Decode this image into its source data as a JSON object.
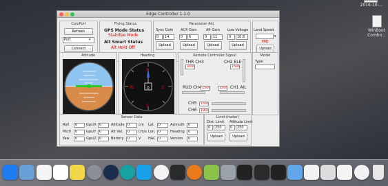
{
  "desktop": {
    "file_label": "2016-10-...",
    "winboot_label_1": "WinBoot",
    "winboot_label_2": "Combo..."
  },
  "window": {
    "title": "Edge Controller 1.1.0"
  },
  "com_port": {
    "header": "ComPort",
    "refresh_label": "Refresh",
    "port_value": "Port",
    "connect_label": "Connect"
  },
  "flying_status": {
    "header": "Flying Status",
    "gps_mode_label": "GPS Mode Status",
    "gps_mode_value": "Stabilize Mode",
    "alt_smart_label": "Alt Smart Status",
    "alt_smart_value": "Alt Hold Off"
  },
  "param_adj": {
    "header": "Parameter Adj.",
    "columns": [
      {
        "label": "Sync Gain",
        "value": "14",
        "upload": "Upload"
      },
      {
        "label": "AUX Gain",
        "value": "6",
        "upload": "Upload"
      },
      {
        "label": "Alt Gain",
        "value": "11",
        "upload": "Upload"
      },
      {
        "label": "Low Voltage",
        "value": "10.8",
        "upload": "Upload"
      }
    ],
    "sync_spin": "0",
    "aux_spin": "0",
    "alt_spin": "0",
    "low_spin": "0"
  },
  "land_speed": {
    "label": "Land Speed",
    "level": "MID",
    "upload": "Upload"
  },
  "attitude": {
    "header": "Attitude"
  },
  "heading": {
    "header": "Heading",
    "n": "N",
    "e": "E",
    "s": "S",
    "w": "W"
  },
  "rc_signal": {
    "header": "Remote Controller Signal",
    "thr_label": "THR CH3",
    "thr_value": "1000",
    "ele_label": "CH2 ELE",
    "ele_value": "1500",
    "rud_label": "RUD CH4",
    "rud_value": "1500",
    "ail_label": "CH1 AIL",
    "ail_value": "1500",
    "ch5_label": "CH5",
    "ch5_value": "1500",
    "ch6_label": "CH6",
    "ch6_value": "1900"
  },
  "model": {
    "header": "Model",
    "type_label": "Type"
  },
  "sensor": {
    "header": "Sensor Data",
    "rows": [
      {
        "l1": "Roll",
        "v1": "0",
        "u1": "Gps/X",
        "v2": "0",
        "l3": "Altitude",
        "v3": "0",
        "u3": "cm",
        "l4": "Lat.",
        "v4": "0"
      },
      {
        "l1": "Pitch",
        "v1": "0",
        "u1": "Gps/Y",
        "v2": "0",
        "l3": "Alt Vel.",
        "v3": "0",
        "u3": "cm/s",
        "l4": "Lon.",
        "v4": "0"
      },
      {
        "l1": "Yaw",
        "v1": "0",
        "u1": "Gps/Z",
        "v2": "0",
        "l3": "Battery",
        "v3": "0",
        "u3": "V",
        "l4": "HAC",
        "v4": "0"
      }
    ],
    "right_rows": [
      {
        "label": "Azimuth",
        "value": "0"
      },
      {
        "label": "Heading",
        "value": "0"
      },
      {
        "label": "Version",
        "value": "0"
      }
    ]
  },
  "limit": {
    "header": "Limit (meter)",
    "dist_label": "Dist. Limit",
    "dist_value": "250",
    "dist_spin": "0",
    "alt_label": "Altitude Limit",
    "alt_value": "250",
    "alt_spin": "0",
    "upload_1": "Upload",
    "upload_2": "Upload"
  },
  "dock_items": [
    "app-store-icon",
    "preview-icon",
    "calendar-icon",
    "notes-icon",
    "stickies-icon",
    "system-preferences-icon",
    "steam-icon",
    "arduino-icon",
    "skype-icon",
    "scratch-icon",
    "unity-icon",
    "blender-icon",
    "android-studio-icon",
    "utility-icon",
    "terminal-icon",
    "amazon-icon",
    "equalizer-icon",
    "folder-icon",
    "document-icon",
    "window-icon",
    "document-icon",
    "chrome-icon",
    "trash-icon"
  ]
}
